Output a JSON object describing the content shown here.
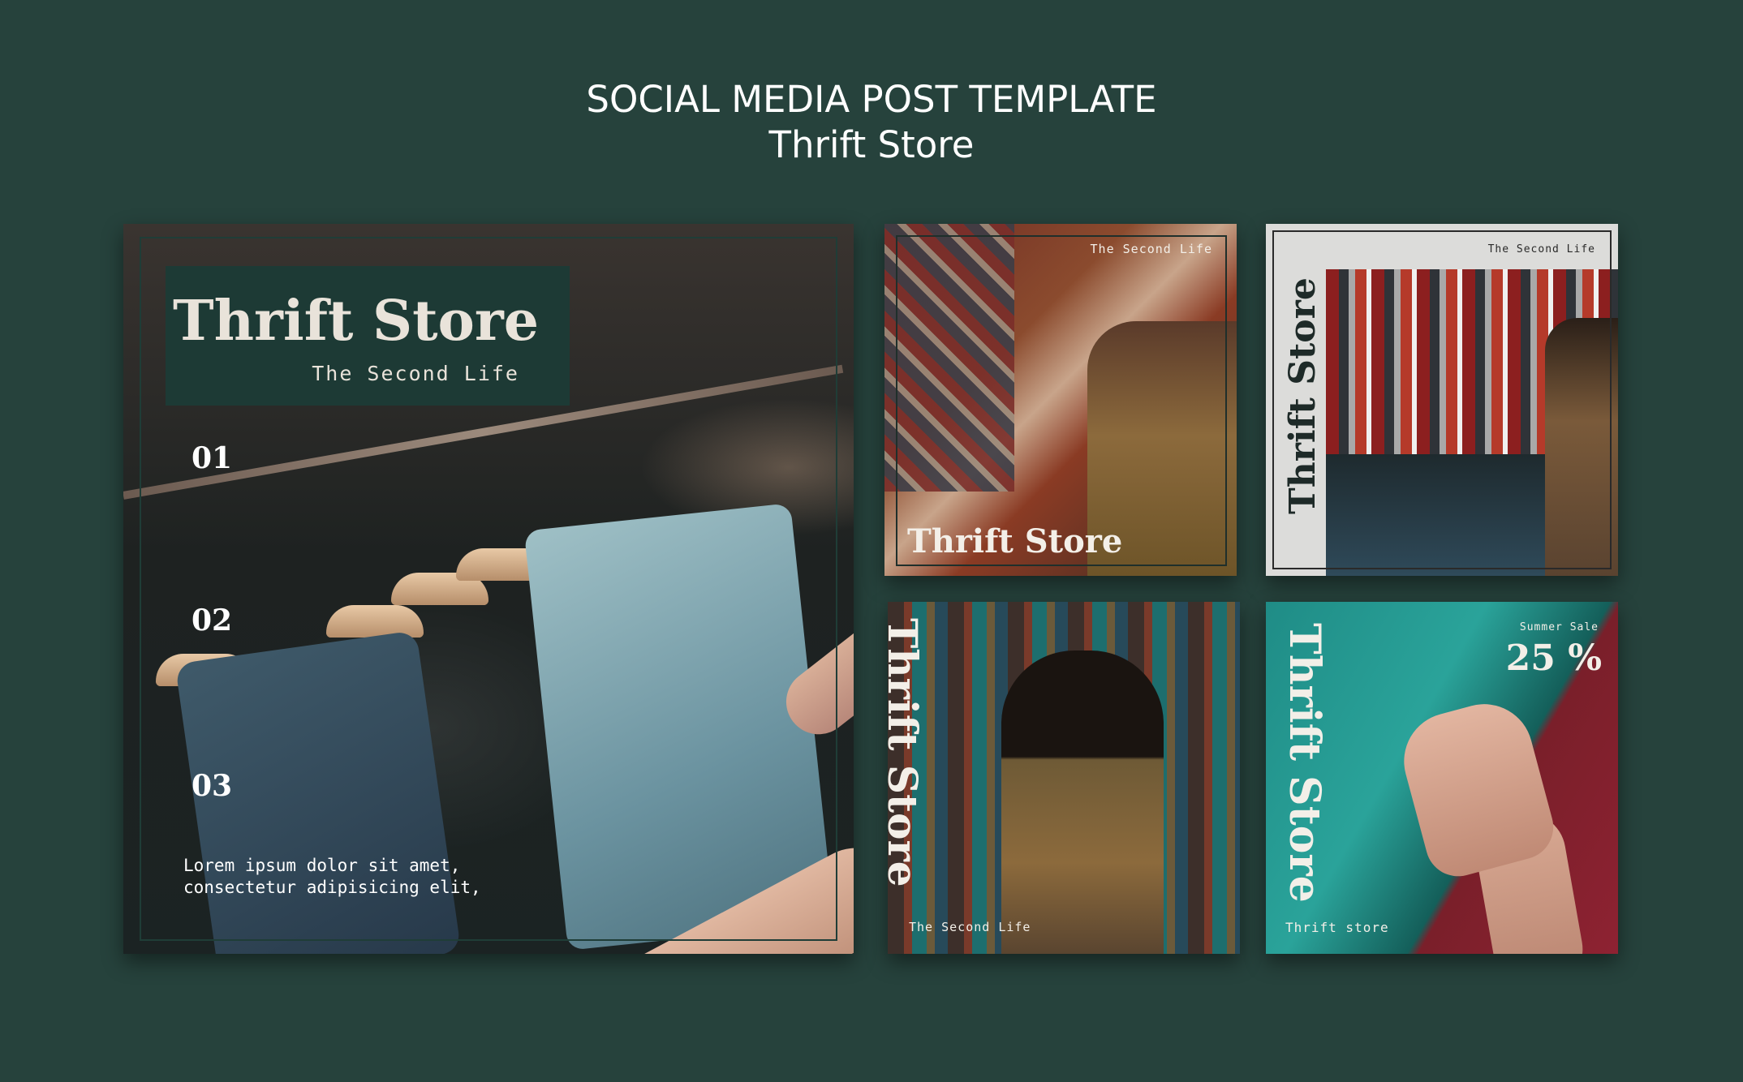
{
  "header": {
    "line1": "SOCIAL MEDIA POST TEMPLATE",
    "line2": "Thrift Store"
  },
  "cards": [
    {
      "title": "Thrift Store",
      "subtitle": "The Second Life",
      "numbers": [
        "01",
        "02",
        "03"
      ],
      "body_lines": [
        "Lorem ipsum dolor sit amet,",
        "consectetur adipisicing elit,"
      ]
    },
    {
      "tagline": "The Second Life",
      "title": "Thrift Store"
    },
    {
      "tagline": "The Second Life",
      "title": "Thrift Store"
    },
    {
      "title": "Thrift Store",
      "tagline": "The Second Life"
    },
    {
      "title": "Thrift Store",
      "sale_label": "Summer Sale",
      "discount": "25 %",
      "tagline": "Thrift store"
    }
  ],
  "colors": {
    "background": "#26423c",
    "title_box": "#1d3a35",
    "text_light": "#f3efe8"
  }
}
